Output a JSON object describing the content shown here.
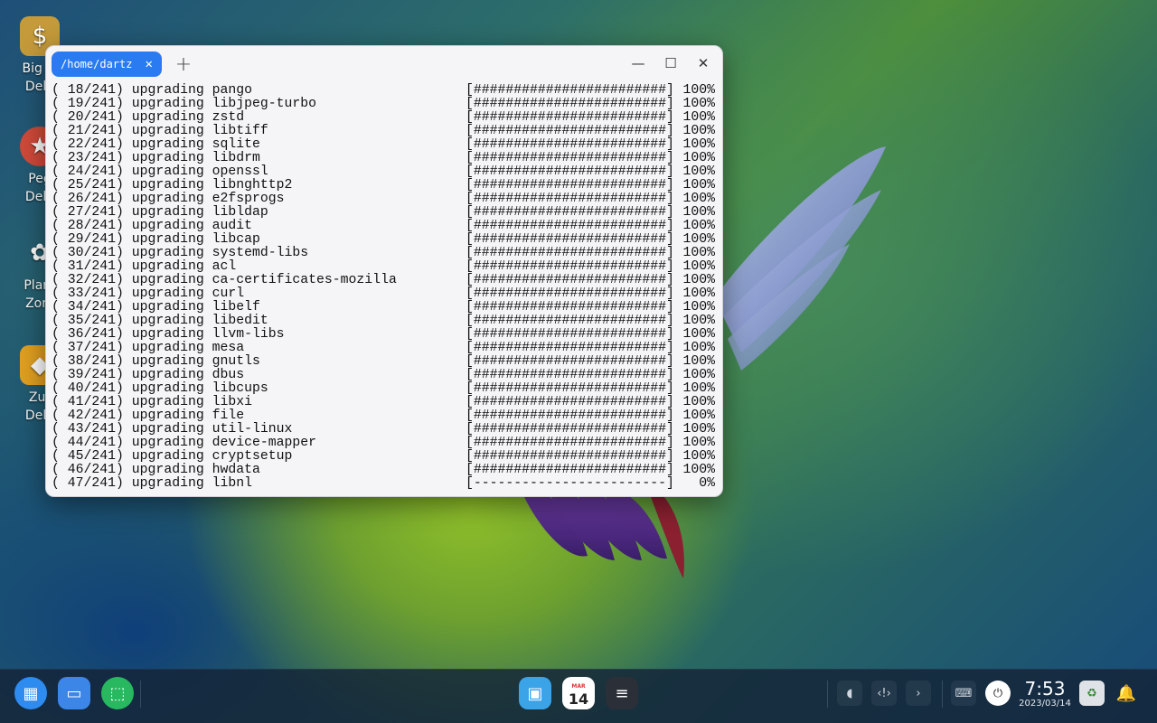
{
  "desktop": {
    "icons": [
      {
        "label": "Big M\nDelu"
      },
      {
        "label": "Peg\nDelu"
      },
      {
        "label": "Plant\nZom"
      },
      {
        "label": "Zur\nDelu"
      }
    ]
  },
  "window": {
    "tab_title": "/home/dartz",
    "tab_close": "✕",
    "new_tab": "+",
    "minimize": "—",
    "maximize": "☐",
    "close": "✕"
  },
  "terminal": {
    "total": 241,
    "rows": [
      {
        "n": " 18",
        "action": "upgrading",
        "pkg": "pango",
        "bar": "[########################]",
        "pct": "100%"
      },
      {
        "n": " 19",
        "action": "upgrading",
        "pkg": "libjpeg-turbo",
        "bar": "[########################]",
        "pct": "100%"
      },
      {
        "n": " 20",
        "action": "upgrading",
        "pkg": "zstd",
        "bar": "[########################]",
        "pct": "100%"
      },
      {
        "n": " 21",
        "action": "upgrading",
        "pkg": "libtiff",
        "bar": "[########################]",
        "pct": "100%"
      },
      {
        "n": " 22",
        "action": "upgrading",
        "pkg": "sqlite",
        "bar": "[########################]",
        "pct": "100%"
      },
      {
        "n": " 23",
        "action": "upgrading",
        "pkg": "libdrm",
        "bar": "[########################]",
        "pct": "100%"
      },
      {
        "n": " 24",
        "action": "upgrading",
        "pkg": "openssl",
        "bar": "[########################]",
        "pct": "100%"
      },
      {
        "n": " 25",
        "action": "upgrading",
        "pkg": "libnghttp2",
        "bar": "[########################]",
        "pct": "100%"
      },
      {
        "n": " 26",
        "action": "upgrading",
        "pkg": "e2fsprogs",
        "bar": "[########################]",
        "pct": "100%"
      },
      {
        "n": " 27",
        "action": "upgrading",
        "pkg": "libldap",
        "bar": "[########################]",
        "pct": "100%"
      },
      {
        "n": " 28",
        "action": "upgrading",
        "pkg": "audit",
        "bar": "[########################]",
        "pct": "100%"
      },
      {
        "n": " 29",
        "action": "upgrading",
        "pkg": "libcap",
        "bar": "[########################]",
        "pct": "100%"
      },
      {
        "n": " 30",
        "action": "upgrading",
        "pkg": "systemd-libs",
        "bar": "[########################]",
        "pct": "100%"
      },
      {
        "n": " 31",
        "action": "upgrading",
        "pkg": "acl",
        "bar": "[########################]",
        "pct": "100%"
      },
      {
        "n": " 32",
        "action": "upgrading",
        "pkg": "ca-certificates-mozilla",
        "bar": "[########################]",
        "pct": "100%"
      },
      {
        "n": " 33",
        "action": "upgrading",
        "pkg": "curl",
        "bar": "[########################]",
        "pct": "100%"
      },
      {
        "n": " 34",
        "action": "upgrading",
        "pkg": "libelf",
        "bar": "[########################]",
        "pct": "100%"
      },
      {
        "n": " 35",
        "action": "upgrading",
        "pkg": "libedit",
        "bar": "[########################]",
        "pct": "100%"
      },
      {
        "n": " 36",
        "action": "upgrading",
        "pkg": "llvm-libs",
        "bar": "[########################]",
        "pct": "100%"
      },
      {
        "n": " 37",
        "action": "upgrading",
        "pkg": "mesa",
        "bar": "[########################]",
        "pct": "100%"
      },
      {
        "n": " 38",
        "action": "upgrading",
        "pkg": "gnutls",
        "bar": "[########################]",
        "pct": "100%"
      },
      {
        "n": " 39",
        "action": "upgrading",
        "pkg": "dbus",
        "bar": "[########################]",
        "pct": "100%"
      },
      {
        "n": " 40",
        "action": "upgrading",
        "pkg": "libcups",
        "bar": "[########################]",
        "pct": "100%"
      },
      {
        "n": " 41",
        "action": "upgrading",
        "pkg": "libxi",
        "bar": "[########################]",
        "pct": "100%"
      },
      {
        "n": " 42",
        "action": "upgrading",
        "pkg": "file",
        "bar": "[########################]",
        "pct": "100%"
      },
      {
        "n": " 43",
        "action": "upgrading",
        "pkg": "util-linux",
        "bar": "[########################]",
        "pct": "100%"
      },
      {
        "n": " 44",
        "action": "upgrading",
        "pkg": "device-mapper",
        "bar": "[########################]",
        "pct": "100%"
      },
      {
        "n": " 45",
        "action": "upgrading",
        "pkg": "cryptsetup",
        "bar": "[########################]",
        "pct": "100%"
      },
      {
        "n": " 46",
        "action": "upgrading",
        "pkg": "hwdata",
        "bar": "[########################]",
        "pct": "100%"
      },
      {
        "n": " 47",
        "action": "upgrading",
        "pkg": "libnl",
        "bar": "[------------------------]",
        "pct": "0%"
      }
    ]
  },
  "taskbar": {
    "launcher_icon": "launcher-icon",
    "calendar_day": "14",
    "calendar_month": "MAR",
    "clock_time": "7:53",
    "clock_date": "2023/03/14",
    "colors": {
      "accent": "#2a7af2",
      "taskbar": "#142337"
    }
  }
}
